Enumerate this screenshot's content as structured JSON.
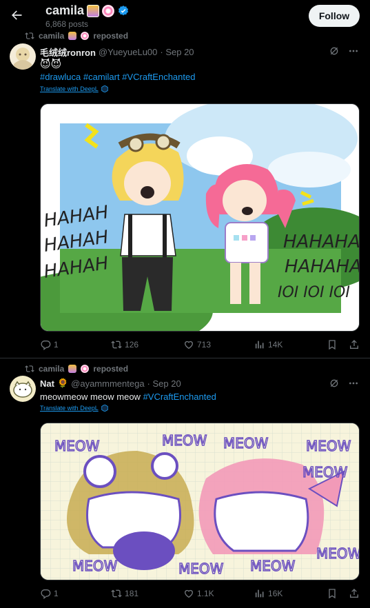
{
  "header": {
    "title": "camila",
    "post_count": "6,868 posts",
    "follow_label": "Follow"
  },
  "tweets": [
    {
      "repost_label": "camila",
      "repost_suffix": "reposted",
      "author_name": "毛绒绒ronron",
      "handle": "@YueyueLu00",
      "date": "· Sep 20",
      "emoji_line": "😈😈",
      "text": "",
      "hashtags": "#drawluca #camilart #VCraftEnchanted",
      "translate": "Translate with DeepL",
      "replies": "1",
      "reposts": "126",
      "likes": "713",
      "views": "14K"
    },
    {
      "repost_label": "camila",
      "repost_suffix": "reposted",
      "author_name": "Nat",
      "author_emoji": "🌻",
      "handle": "@ayammmentega",
      "date": "· Sep 20",
      "text": "meowmeow meow meow",
      "hashtags": "#VCraftEnchanted",
      "translate": "Translate with DeepL",
      "replies": "1",
      "reposts": "181",
      "likes": "1.1K",
      "views": "16K"
    }
  ],
  "art1": {
    "left_text_1": "HAHAH",
    "left_text_2": "HAHAH",
    "left_text_3": "HAHAH",
    "right_text_1": "HAHAHA",
    "right_text_2": "HAHAHA",
    "right_text_3": "IOI IOI IOI"
  },
  "art2": {
    "meow": "MEOW"
  }
}
